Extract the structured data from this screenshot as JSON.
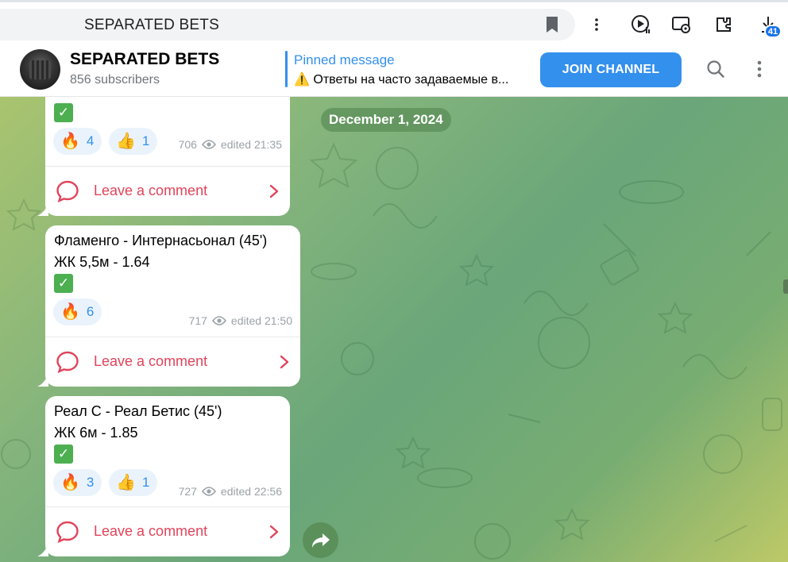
{
  "browser": {
    "tab_title": "SEPARATED BETS",
    "download_count": "41",
    "icons": [
      "bookmark-icon",
      "more-vert-icon",
      "media-control-icon",
      "screen-cast-icon",
      "extensions-icon",
      "downloads-icon"
    ]
  },
  "header": {
    "channel_name": "SEPARATED BETS",
    "subscribers": "856 subscribers",
    "pinned_title": "Pinned message",
    "pinned_text": "⚠️ Ответы на часто задаваемые в...",
    "join_label": "JOIN CHANNEL"
  },
  "chat": {
    "date": "December 1, 2024",
    "messages": [
      {
        "reactions": [
          {
            "emoji": "🔥",
            "count": "4"
          },
          {
            "emoji": "👍",
            "count": "1"
          }
        ],
        "views": "706",
        "edited": "edited 21:35",
        "comment_label": "Leave a comment"
      },
      {
        "line1": "Фламенго - Интернасьонал (45')",
        "line2": "ЖК 5,5м - 1.64",
        "reactions": [
          {
            "emoji": "🔥",
            "count": "6"
          }
        ],
        "views": "717",
        "edited": "edited 21:50",
        "comment_label": "Leave a comment"
      },
      {
        "line1": "Реал С - Реал Бетис (45')",
        "line2": "ЖК 6м - 1.85",
        "reactions": [
          {
            "emoji": "🔥",
            "count": "3"
          },
          {
            "emoji": "👍",
            "count": "1"
          }
        ],
        "views": "727",
        "edited": "edited 22:56",
        "comment_label": "Leave a comment"
      }
    ]
  },
  "colors": {
    "accent": "#3390ec",
    "comment": "#e0445a",
    "check": "#4caf50"
  }
}
